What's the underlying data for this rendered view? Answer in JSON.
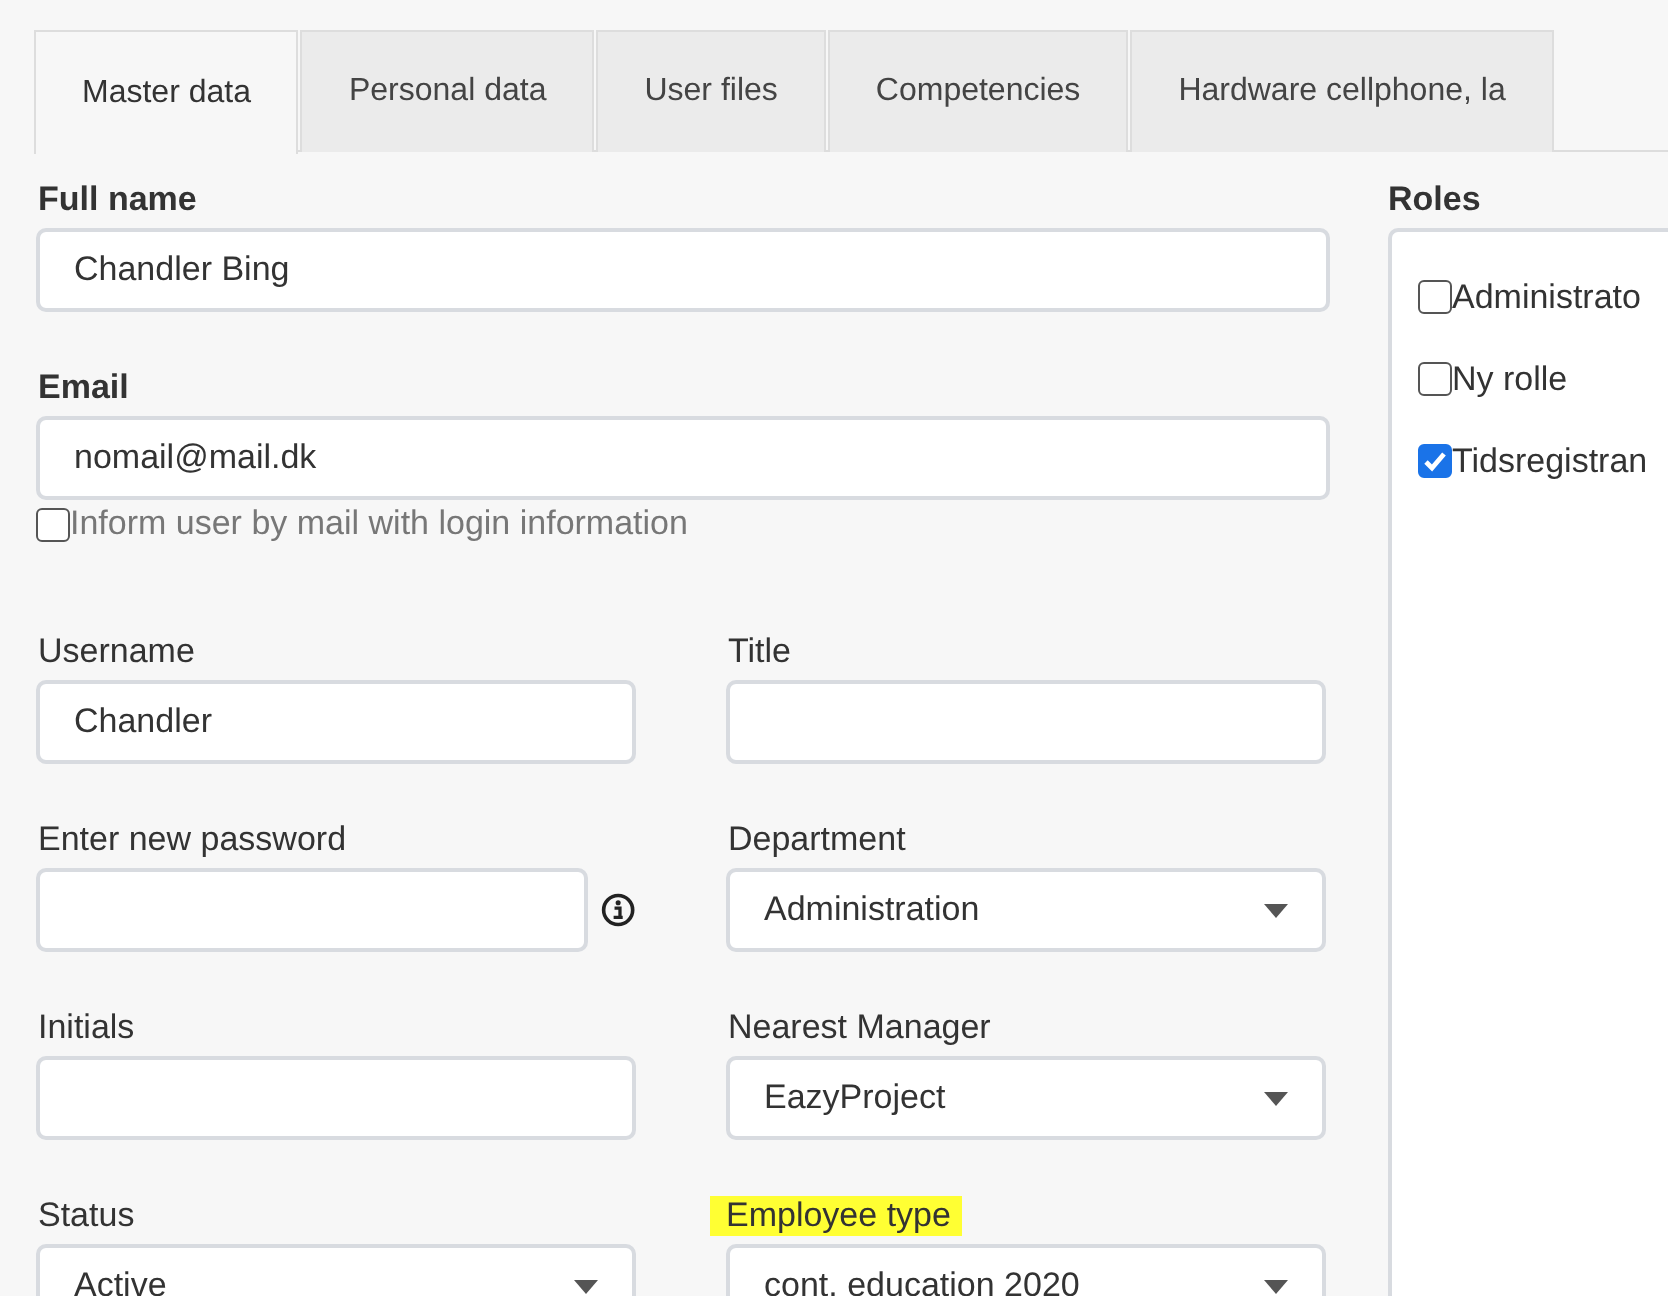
{
  "tabs": [
    {
      "label": "Master data",
      "selected": true
    },
    {
      "label": "Personal data",
      "selected": false
    },
    {
      "label": "User files",
      "selected": false
    },
    {
      "label": "Competencies",
      "selected": false
    },
    {
      "label": "Hardware cellphone, la",
      "selected": false
    }
  ],
  "full_name": {
    "label": "Full name",
    "value": "Chandler Bing"
  },
  "email": {
    "label": "Email",
    "value": "nomail@mail.dk"
  },
  "inform_checkbox": {
    "label": "Inform user by mail with login information",
    "checked": false
  },
  "fields": [
    {
      "label": "Username",
      "kind": "text",
      "value": "Chandler",
      "highlighted": false
    },
    {
      "label": "Title",
      "kind": "text",
      "highlighted": false
    },
    {
      "label": "Enter new password",
      "kind": "password",
      "highlighted": false
    },
    {
      "label": "Department",
      "kind": "select",
      "value": "Administration",
      "highlighted": false
    },
    {
      "label": "Initials",
      "kind": "text",
      "highlighted": false
    },
    {
      "label": "Nearest Manager",
      "kind": "select",
      "value": "EazyProject",
      "highlighted": false
    },
    {
      "label": "Status",
      "kind": "select",
      "value": "Active",
      "highlighted": false
    },
    {
      "label": "Employee type",
      "kind": "select",
      "value": "cont. education 2020",
      "highlighted": true
    }
  ],
  "roles": {
    "label": "Roles",
    "items": [
      {
        "label": "Administrato",
        "checked": false
      },
      {
        "label": "Ny rolle",
        "checked": false
      },
      {
        "label": "Tidsregistran",
        "checked": true
      }
    ]
  }
}
